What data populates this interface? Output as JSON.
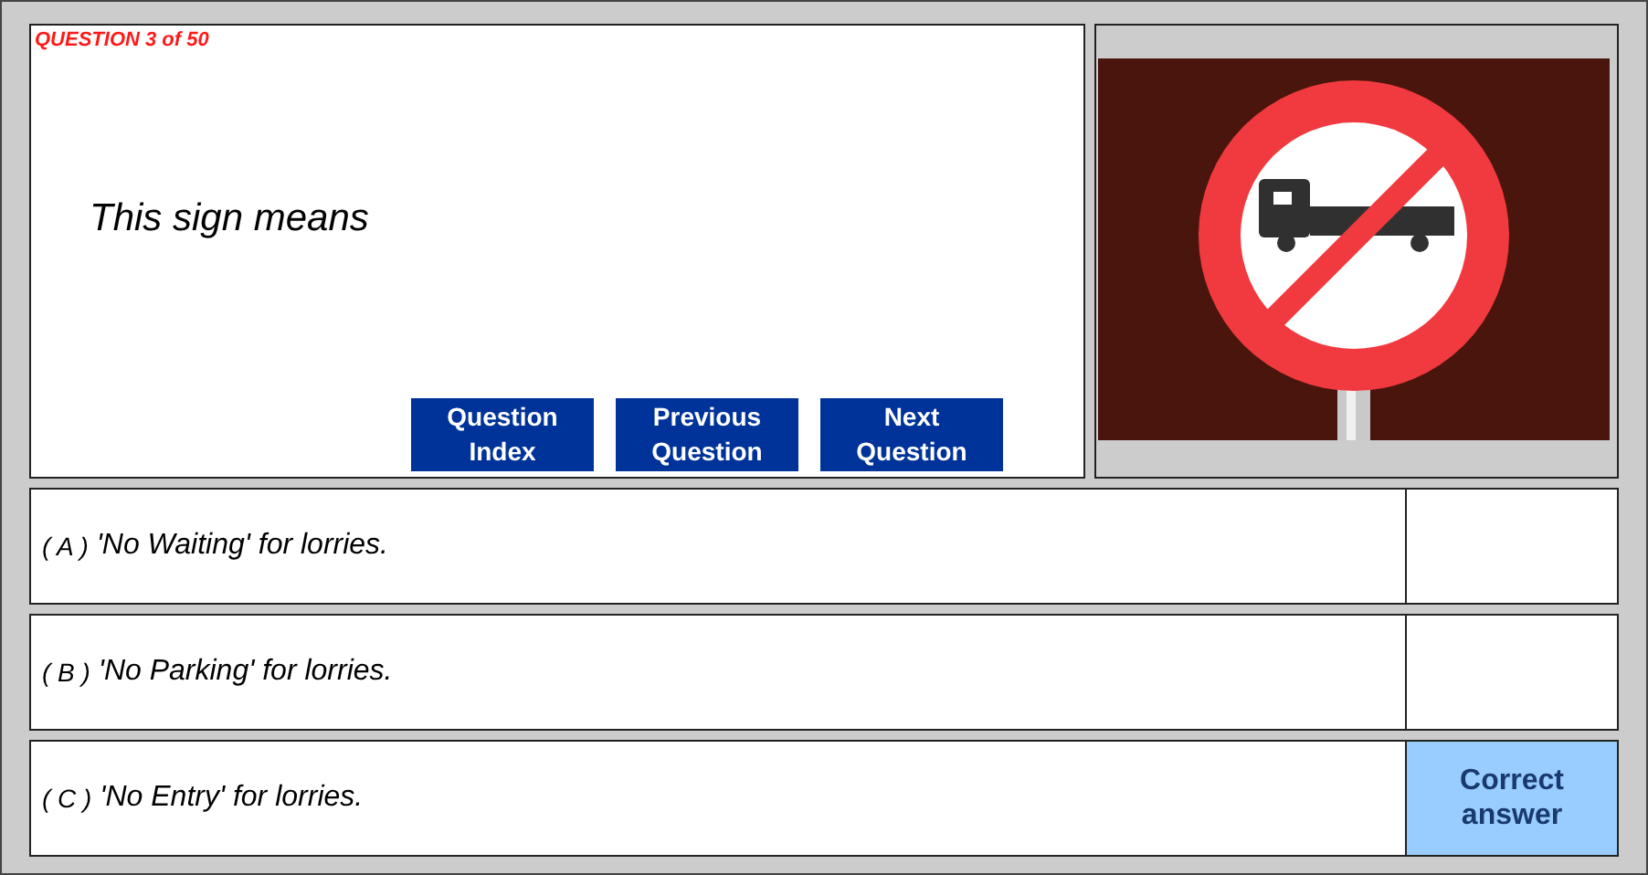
{
  "question": {
    "counter": "QUESTION 3 of 50",
    "text": "This sign means"
  },
  "buttons": [
    {
      "label": "Question Index"
    },
    {
      "label": "Previous Question"
    },
    {
      "label": "Next Question"
    }
  ],
  "options": [
    {
      "letter": "( A )",
      "text": "'No Waiting' for lorries.",
      "correct": false
    },
    {
      "letter": "( B )",
      "text": "'No Parking' for lorries.",
      "correct": false
    },
    {
      "letter": "( C )",
      "text": "'No Entry' for lorries.",
      "correct": true,
      "feedback": "Correct answer"
    }
  ]
}
